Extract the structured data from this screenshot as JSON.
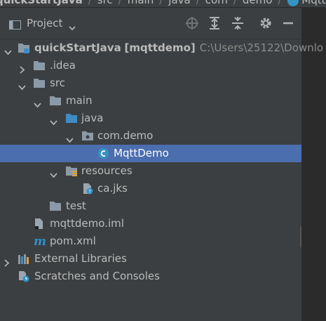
{
  "breadcrumb": {
    "project": "quickStartJava",
    "segments": [
      "src",
      "main",
      "java",
      "com",
      "demo"
    ],
    "file": "MqttDemo"
  },
  "panel": {
    "title": "Project",
    "icons": [
      "locate-icon",
      "expand-all-icon",
      "collapse-all-icon",
      "settings-gear-icon",
      "hide-minus-icon"
    ]
  },
  "tree": {
    "root_name": "quickStartJava",
    "root_module": "[mqttdemo]",
    "root_path": "C:\\Users\\25122\\Downlo",
    "idea": ".idea",
    "src": "src",
    "main": "main",
    "java": "java",
    "package": "com.demo",
    "class": "MqttDemo",
    "resources": "resources",
    "resource_file": "ca.jks",
    "test": "test",
    "iml": "mqttdemo.iml",
    "pom": "pom.xml",
    "external": "External Libraries",
    "scratches": "Scratches and Consoles"
  },
  "colors": {
    "background": "#3c3f41",
    "selection": "#4b6eaf",
    "folder": "#8a9aa8",
    "source_folder": "#3f8bc4",
    "class_icon": "#3592c4",
    "maven": "#2f8fcf"
  }
}
